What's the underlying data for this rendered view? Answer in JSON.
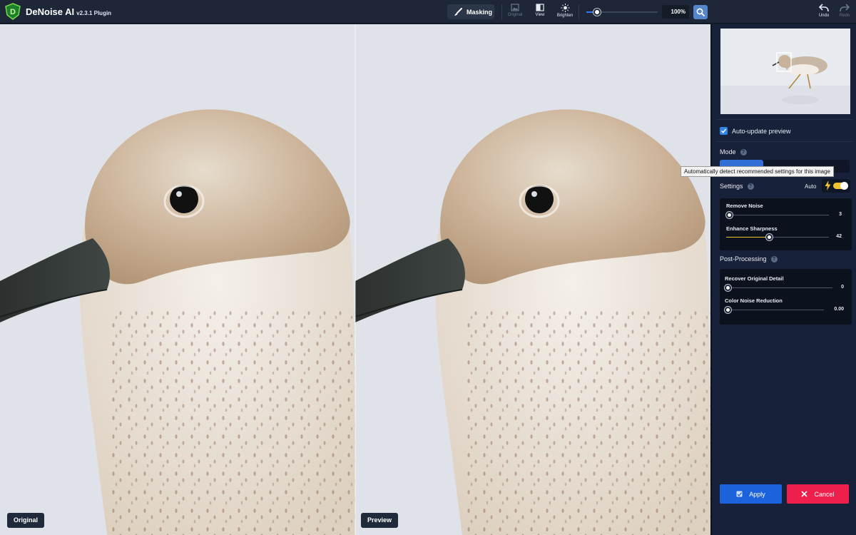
{
  "app": {
    "name": "DeNoise AI",
    "version": "v2.3.1 Plugin"
  },
  "toolbar": {
    "masking_label": "Masking",
    "original_label": "Original",
    "view_label": "View",
    "brighten_label": "Brighten",
    "zoom_value": "100%",
    "zoom_level_fraction": 0.15,
    "undo_label": "Undo",
    "redo_label": "Redo"
  },
  "canvas": {
    "original_label": "Original",
    "preview_label": "Preview"
  },
  "panel": {
    "auto_update_label": "Auto-update preview",
    "auto_update_checked": true,
    "mode_title": "Mode",
    "settings_title": "Settings",
    "auto_label": "Auto",
    "tooltip": "Automatically detect recommended settings for this image",
    "sliders": [
      {
        "label": "Remove Noise",
        "value": "3",
        "fraction": 0.03
      },
      {
        "label": "Enhance Sharpness",
        "value": "42",
        "fraction": 0.42
      }
    ],
    "post_title": "Post-Processing",
    "post_sliders": [
      {
        "label": "Recover Original Detail",
        "value": "0",
        "fraction": 0.0
      },
      {
        "label": "Color Noise Reduction",
        "value": "0.00",
        "fraction": 0.0
      }
    ],
    "apply_label": "Apply",
    "cancel_label": "Cancel"
  },
  "colors": {
    "accent": "#2f78ff",
    "slider_fill": "#f1c232",
    "apply": "#1d62dd",
    "cancel": "#ef1e4b",
    "panel_bg": "#17223a"
  }
}
